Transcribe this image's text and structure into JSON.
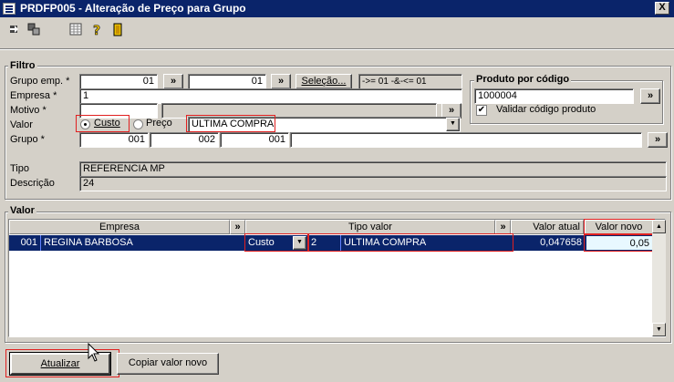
{
  "window": {
    "title": "PRDFP005 - Alteração de Preço para Grupo",
    "close_label": "X"
  },
  "toolbar": {
    "icons": [
      "exit-icon",
      "window-icon",
      "calculator-icon",
      "help-icon",
      "door-icon"
    ]
  },
  "filtro": {
    "legend": "Filtro",
    "grupo_emp": {
      "label": "Grupo emp. *",
      "from": "01",
      "to": "01",
      "selecao_label": "Seleção...",
      "selecao_info": "->= 01 -&-<= 01"
    },
    "empresa": {
      "label": "Empresa *",
      "value": "1"
    },
    "motivo": {
      "label": "Motivo *",
      "value": "",
      "desc": ""
    },
    "valor": {
      "label": "Valor",
      "option_custo": "Custo",
      "option_preco": "Preço",
      "selected": "Custo",
      "combo_value": "ULTIMA COMPRA"
    },
    "grupo": {
      "label": "Grupo *",
      "part1": "001",
      "part2": "002",
      "part3": "001",
      "desc": ""
    },
    "tipo": {
      "label": "Tipo",
      "value": "REFERENCIA MP"
    },
    "descricao": {
      "label": "Descrição",
      "value": "24"
    }
  },
  "produto": {
    "legend": "Produto por código",
    "value": "1000004",
    "validar_label": "Validar código produto",
    "validar_checked": true
  },
  "valor_section": {
    "legend": "Valor",
    "columns": {
      "empresa": "Empresa",
      "tipo_valor": "Tipo valor",
      "valor_atual": "Valor atual",
      "valor_novo": "Valor novo"
    },
    "rows": [
      {
        "empresa_code": "001",
        "empresa_name": "REGINA BARBOSA",
        "tipo": "Custo",
        "tipo_code": "2",
        "tipo_desc": "ULTIMA COMPRA",
        "valor_atual": "0,047658",
        "valor_novo": "0,05"
      }
    ]
  },
  "actions": {
    "atualizar": "Atualizar",
    "copiar": "Copiar valor novo"
  },
  "dbl_label": "»"
}
